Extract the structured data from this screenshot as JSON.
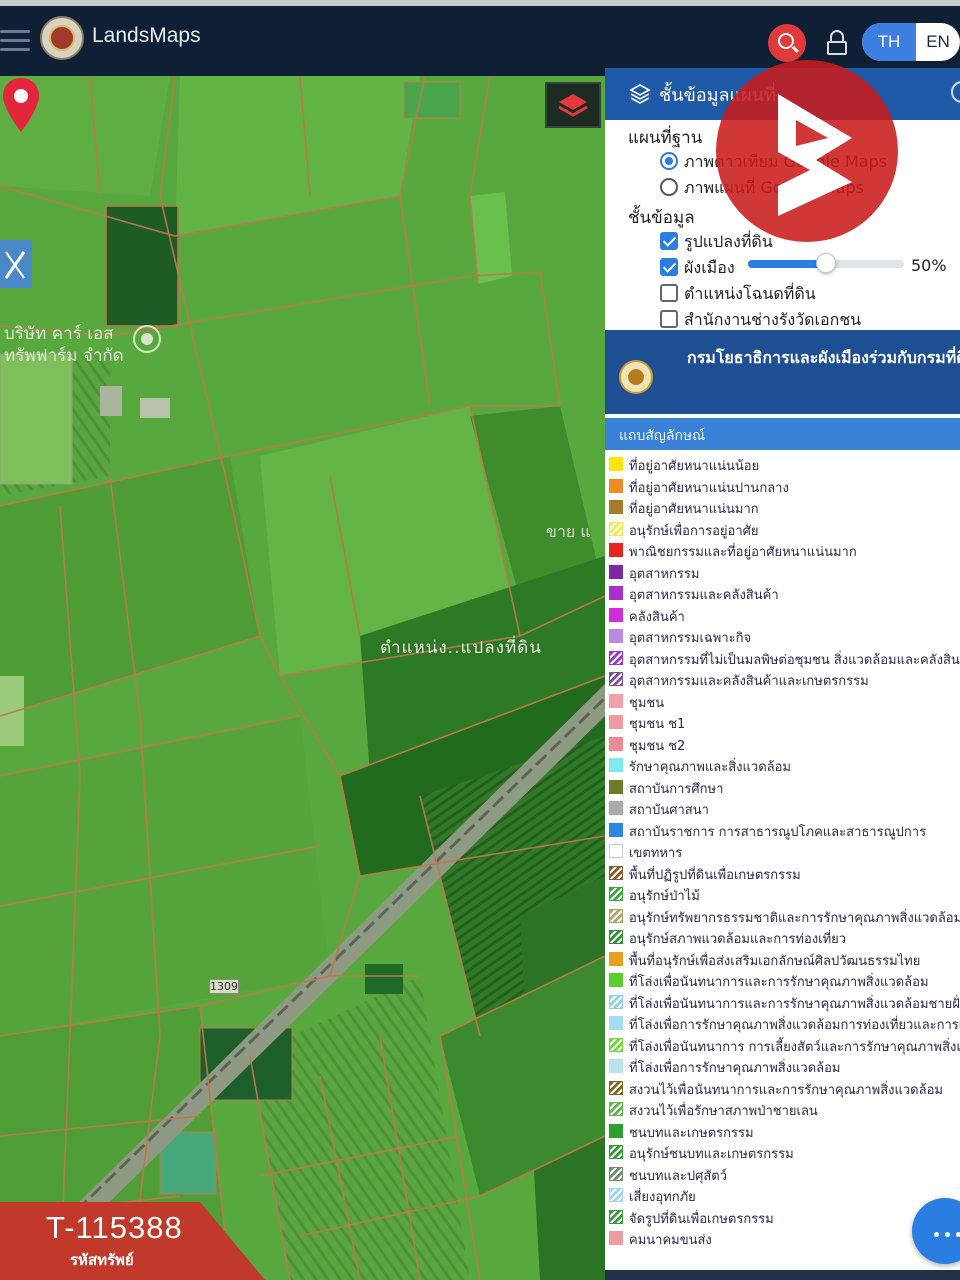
{
  "header": {
    "app_title": "LandsMaps",
    "lang_th": "TH",
    "lang_en": "EN"
  },
  "map": {
    "pin_caption": "ตำแหน่ง..แปลงที่ดิน",
    "label_company_1": "บริษัท คาร์ เอส",
    "label_company_2": "ทรัพฟาร์ม จำกัด",
    "label_sale": "ขาย แ",
    "road_number": "1309",
    "asset_id": "T-115388",
    "asset_label": "รหัสทรัพย์"
  },
  "panel": {
    "title": "ชั้นข้อมูลแผนที่",
    "basemap_title": "แผนที่ฐาน",
    "basemap_options": [
      {
        "label": "ภาพดาวเทียม Google Maps",
        "selected": true
      },
      {
        "label": "ภาพแผนที่ Google Maps",
        "selected": false
      }
    ],
    "layers_title": "ชั้นข้อมูล",
    "layers": [
      {
        "label": "รูปแปลงที่ดิน",
        "checked": true
      },
      {
        "label": "ผังเมือง",
        "checked": true
      },
      {
        "label": "ตำแหน่งโฉนดที่ดิน",
        "checked": false
      },
      {
        "label": "สำนักงานช่างรังวัดเอกชน",
        "checked": false
      }
    ],
    "opacity": 50,
    "opacity_label": "50%",
    "dept_text": "กรมโยธาธิการและผังเมืองร่วมกับกรมที่ดิน",
    "legend_title": "แถบสัญลักษณ์",
    "legend": [
      {
        "label": "ที่อยู่อาศัยหนาแน่นน้อย",
        "color": "#f5e60d",
        "hatch": false
      },
      {
        "label": "ที่อยู่อาศัยหนาแน่นปานกลาง",
        "color": "#f08a24",
        "hatch": false
      },
      {
        "label": "ที่อยู่อาศัยหนาแน่นมาก",
        "color": "#a67c2a",
        "hatch": false
      },
      {
        "label": "อนุรักษ์เพื่อการอยู่อาศัย",
        "color": "#f2e94e",
        "hatch": true
      },
      {
        "label": "พาณิชยกรรมและที่อยู่อาศัยหนาแน่นมาก",
        "color": "#e8241f",
        "hatch": false
      },
      {
        "label": "อุตสาหกรรม",
        "color": "#7b2aa3",
        "hatch": false
      },
      {
        "label": "อุตสาหกรรมและคลังสินค้า",
        "color": "#a830c9",
        "hatch": false
      },
      {
        "label": "คลังสินค้า",
        "color": "#d12cdc",
        "hatch": false
      },
      {
        "label": "อุตสาหกรรมเฉพาะกิจ",
        "color": "#b98ae0",
        "hatch": false
      },
      {
        "label": "อุตสาหกรรมที่ไม่เป็นมลพิษต่อชุมชน สิ่งแวดล้อมและคลังสินค้า",
        "color": "#9b36c8",
        "hatch": true
      },
      {
        "label": "อุตสาหกรรมและคลังสินค้าและเกษตรกรรม",
        "color": "#7f4fa0",
        "hatch": true
      },
      {
        "label": "ชุมชน",
        "color": "#f0a0a8",
        "hatch": false
      },
      {
        "label": "ชุมชน ช1",
        "color": "#ee9aa2",
        "hatch": false
      },
      {
        "label": "ชุมชน ช2",
        "color": "#e98a96",
        "hatch": false
      },
      {
        "label": "รักษาคุณภาพและสิ่งแวดล้อม",
        "color": "#7ce9ee",
        "hatch": false
      },
      {
        "label": "สถาบันการศึกษา",
        "color": "#6e7c2a",
        "hatch": false
      },
      {
        "label": "สถาบันศาสนา",
        "color": "#aaaaaa",
        "hatch": false
      },
      {
        "label": "สถาบันราชการ การสาธารณูปโภคและสาธารณูปการ",
        "color": "#2d86e2",
        "hatch": false
      },
      {
        "label": "เขตทหาร",
        "color": "#ffffff",
        "hatch": false
      },
      {
        "label": "พื้นที่ปฏิรูปที่ดินเพื่อเกษตรกรรม",
        "color": "#8b5a2b",
        "hatch": true
      },
      {
        "label": "อนุรักษ์ป่าไม้",
        "color": "#3aa83a",
        "hatch": true
      },
      {
        "label": "อนุรักษ์ทรัพยากรธรรมชาติและการรักษาคุณภาพสิ่งแวดล้อม",
        "color": "#b2a36a",
        "hatch": true
      },
      {
        "label": "อนุรักษ์สภาพแวดล้อมและการท่องเที่ยว",
        "color": "#2f8f3a",
        "hatch": true
      },
      {
        "label": "พื้นที่อนุรักษ์เพื่อส่งเสริมเอกลักษณ์ศิลปวัฒนธรรมไทย",
        "color": "#e8a020",
        "hatch": false
      },
      {
        "label": "ที่โล่งเพื่อนันทนาการและการรักษาคุณภาพสิ่งแวดล้อม",
        "color": "#55d12a",
        "hatch": false
      },
      {
        "label": "ที่โล่งเพื่อนันทนาการและการรักษาคุณภาพสิ่งแวดล้อมชายฝั่ง",
        "color": "#8fd0ea",
        "hatch": true
      },
      {
        "label": "ที่โล่งเพื่อการรักษาคุณภาพสิ่งแวดล้อมการท่องเที่ยวและการเกษตร",
        "color": "#a6dcef",
        "hatch": false
      },
      {
        "label": "ที่โล่งเพื่อนันทนาการ การเลี้ยงสัตว์และการรักษาคุณภาพสิ่งแวดล้อม",
        "color": "#6ed83a",
        "hatch": true
      },
      {
        "label": "ที่โล่งเพื่อการรักษาคุณภาพสิ่งแวดล้อม",
        "color": "#b8e4ec",
        "hatch": false
      },
      {
        "label": "สงวนไว้เพื่อนันทนาการและการรักษาคุณภาพสิ่งแวดล้อม",
        "color": "#7c6a1a",
        "hatch": true
      },
      {
        "label": "สงวนไว้เพื่อรักษาสภาพป่าชายเลน",
        "color": "#5cb84a",
        "hatch": true
      },
      {
        "label": "ชนบทและเกษตรกรรม",
        "color": "#2f9e2f",
        "hatch": false
      },
      {
        "label": "อนุรักษ์ชนบทและเกษตรกรรม",
        "color": "#2f9e2f",
        "hatch": true
      },
      {
        "label": "ชนบทและปศุสัตว์",
        "color": "#6f8f6a",
        "hatch": true
      },
      {
        "label": "เสี่ยงอุทกภัย",
        "color": "#9fd8ee",
        "hatch": true
      },
      {
        "label": "จัดรูปที่ดินเพื่อเกษตรกรรม",
        "color": "#3e9a3e",
        "hatch": true
      },
      {
        "label": "คมนาคมขนส่ง",
        "color": "#ee9aa2",
        "hatch": false
      }
    ]
  },
  "colors": {
    "header_bg": "#0f1f35",
    "panel_blue": "#1e5aa8",
    "accent": "#2a7de1",
    "pin": "#e3263c"
  }
}
